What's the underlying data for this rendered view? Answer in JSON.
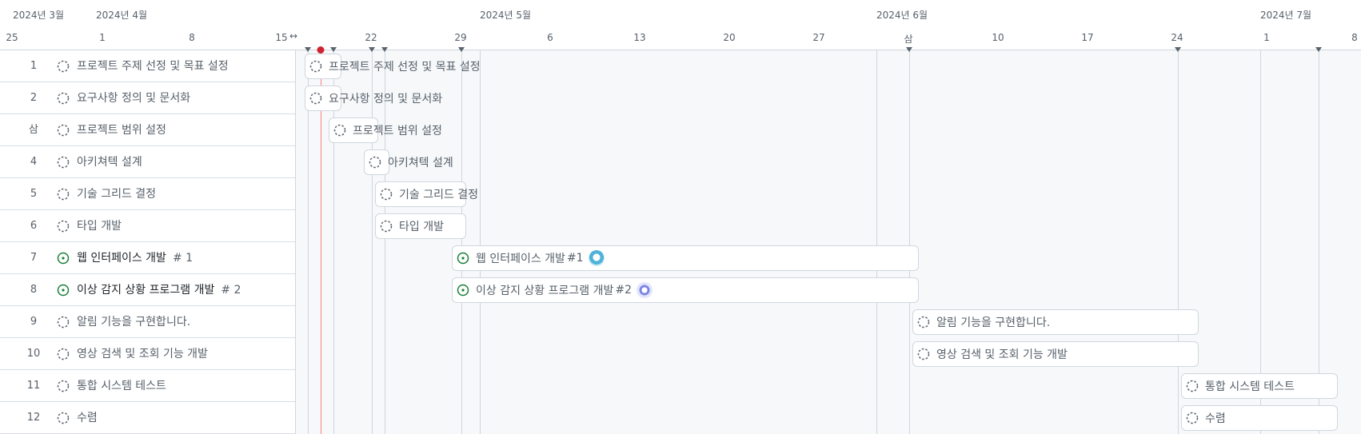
{
  "months": [
    "2024년 3월",
    "2024년 4월",
    "2024년 5월",
    "2024년 6월",
    "2024년 7월"
  ],
  "ticks": [
    "25",
    "1",
    "8",
    "15",
    "22",
    "29",
    "6",
    "13",
    "20",
    "27",
    "삼",
    "10",
    "17",
    "24",
    "1",
    "8"
  ],
  "rows": [
    {
      "num": "1",
      "title": "프로젝트 주제 선정 및 목표 설정",
      "issue": "",
      "status": "draft"
    },
    {
      "num": "2",
      "title": "요구사항 정의 및 문서화",
      "issue": "",
      "status": "draft"
    },
    {
      "num": "삼",
      "title": "프로젝트 범위 설정",
      "issue": "",
      "status": "draft"
    },
    {
      "num": "4",
      "title": "아키쳐텍 설계",
      "issue": "",
      "status": "draft"
    },
    {
      "num": "5",
      "title": "기술 그리드 결정",
      "issue": "",
      "status": "draft"
    },
    {
      "num": "6",
      "title": "타입 개발",
      "issue": "",
      "status": "draft"
    },
    {
      "num": "7",
      "title": "웹 인터페이스 개발",
      "issue": "# 1",
      "status": "open"
    },
    {
      "num": "8",
      "title": "이상 감지 상황 프로그램 개발",
      "issue": "# 2",
      "status": "open"
    },
    {
      "num": "9",
      "title": "알림 기능을 구현합니다.",
      "issue": "",
      "status": "draft"
    },
    {
      "num": "10",
      "title": "영상 검색 및 조회 기능 개발",
      "issue": "",
      "status": "draft"
    },
    {
      "num": "11",
      "title": "통합 시스템 테스트",
      "issue": "",
      "status": "draft"
    },
    {
      "num": "12",
      "title": "수렴",
      "issue": "",
      "status": "draft"
    }
  ],
  "bars": [
    {
      "label": "프로젝트 주제 선정 및 목표 설정",
      "num": "",
      "status": "draft",
      "avatar": ""
    },
    {
      "label": "요구사항 정의 및 문서화",
      "num": "",
      "status": "draft",
      "avatar": ""
    },
    {
      "label": "프로젝트 범위 설정",
      "num": "",
      "status": "draft",
      "avatar": ""
    },
    {
      "label": "아키쳐텍 설계",
      "num": "",
      "status": "draft",
      "avatar": ""
    },
    {
      "label": "기술 그리드 결정",
      "num": "",
      "status": "draft",
      "avatar": ""
    },
    {
      "label": "타입 개발",
      "num": "",
      "status": "draft",
      "avatar": ""
    },
    {
      "label": "웹 인터페이스 개발",
      "num": "#1",
      "status": "open",
      "avatar": "avatar-1"
    },
    {
      "label": "이상 감지 상황 프로그램 개발",
      "num": "#2",
      "status": "open",
      "avatar": "avatar-2"
    },
    {
      "label": "알림 기능을 구현합니다.",
      "num": "",
      "status": "draft",
      "avatar": ""
    },
    {
      "label": "영상 검색 및 조회 기능 개발",
      "num": "",
      "status": "draft",
      "avatar": ""
    },
    {
      "label": "통합 시스템 테스트",
      "num": "",
      "status": "draft",
      "avatar": ""
    },
    {
      "label": "수렴",
      "num": "",
      "status": "draft",
      "avatar": ""
    }
  ],
  "colors": {
    "today": "#cf222e",
    "open_status": "#1a7f37",
    "draft_status": "#59636e",
    "grid": "#d0d7de",
    "timeline_bg": "#f6f8fa"
  },
  "icons": {
    "draft": "dashed-circle-icon",
    "open": "issue-opened-icon",
    "handle": "drag-handle-icon"
  }
}
